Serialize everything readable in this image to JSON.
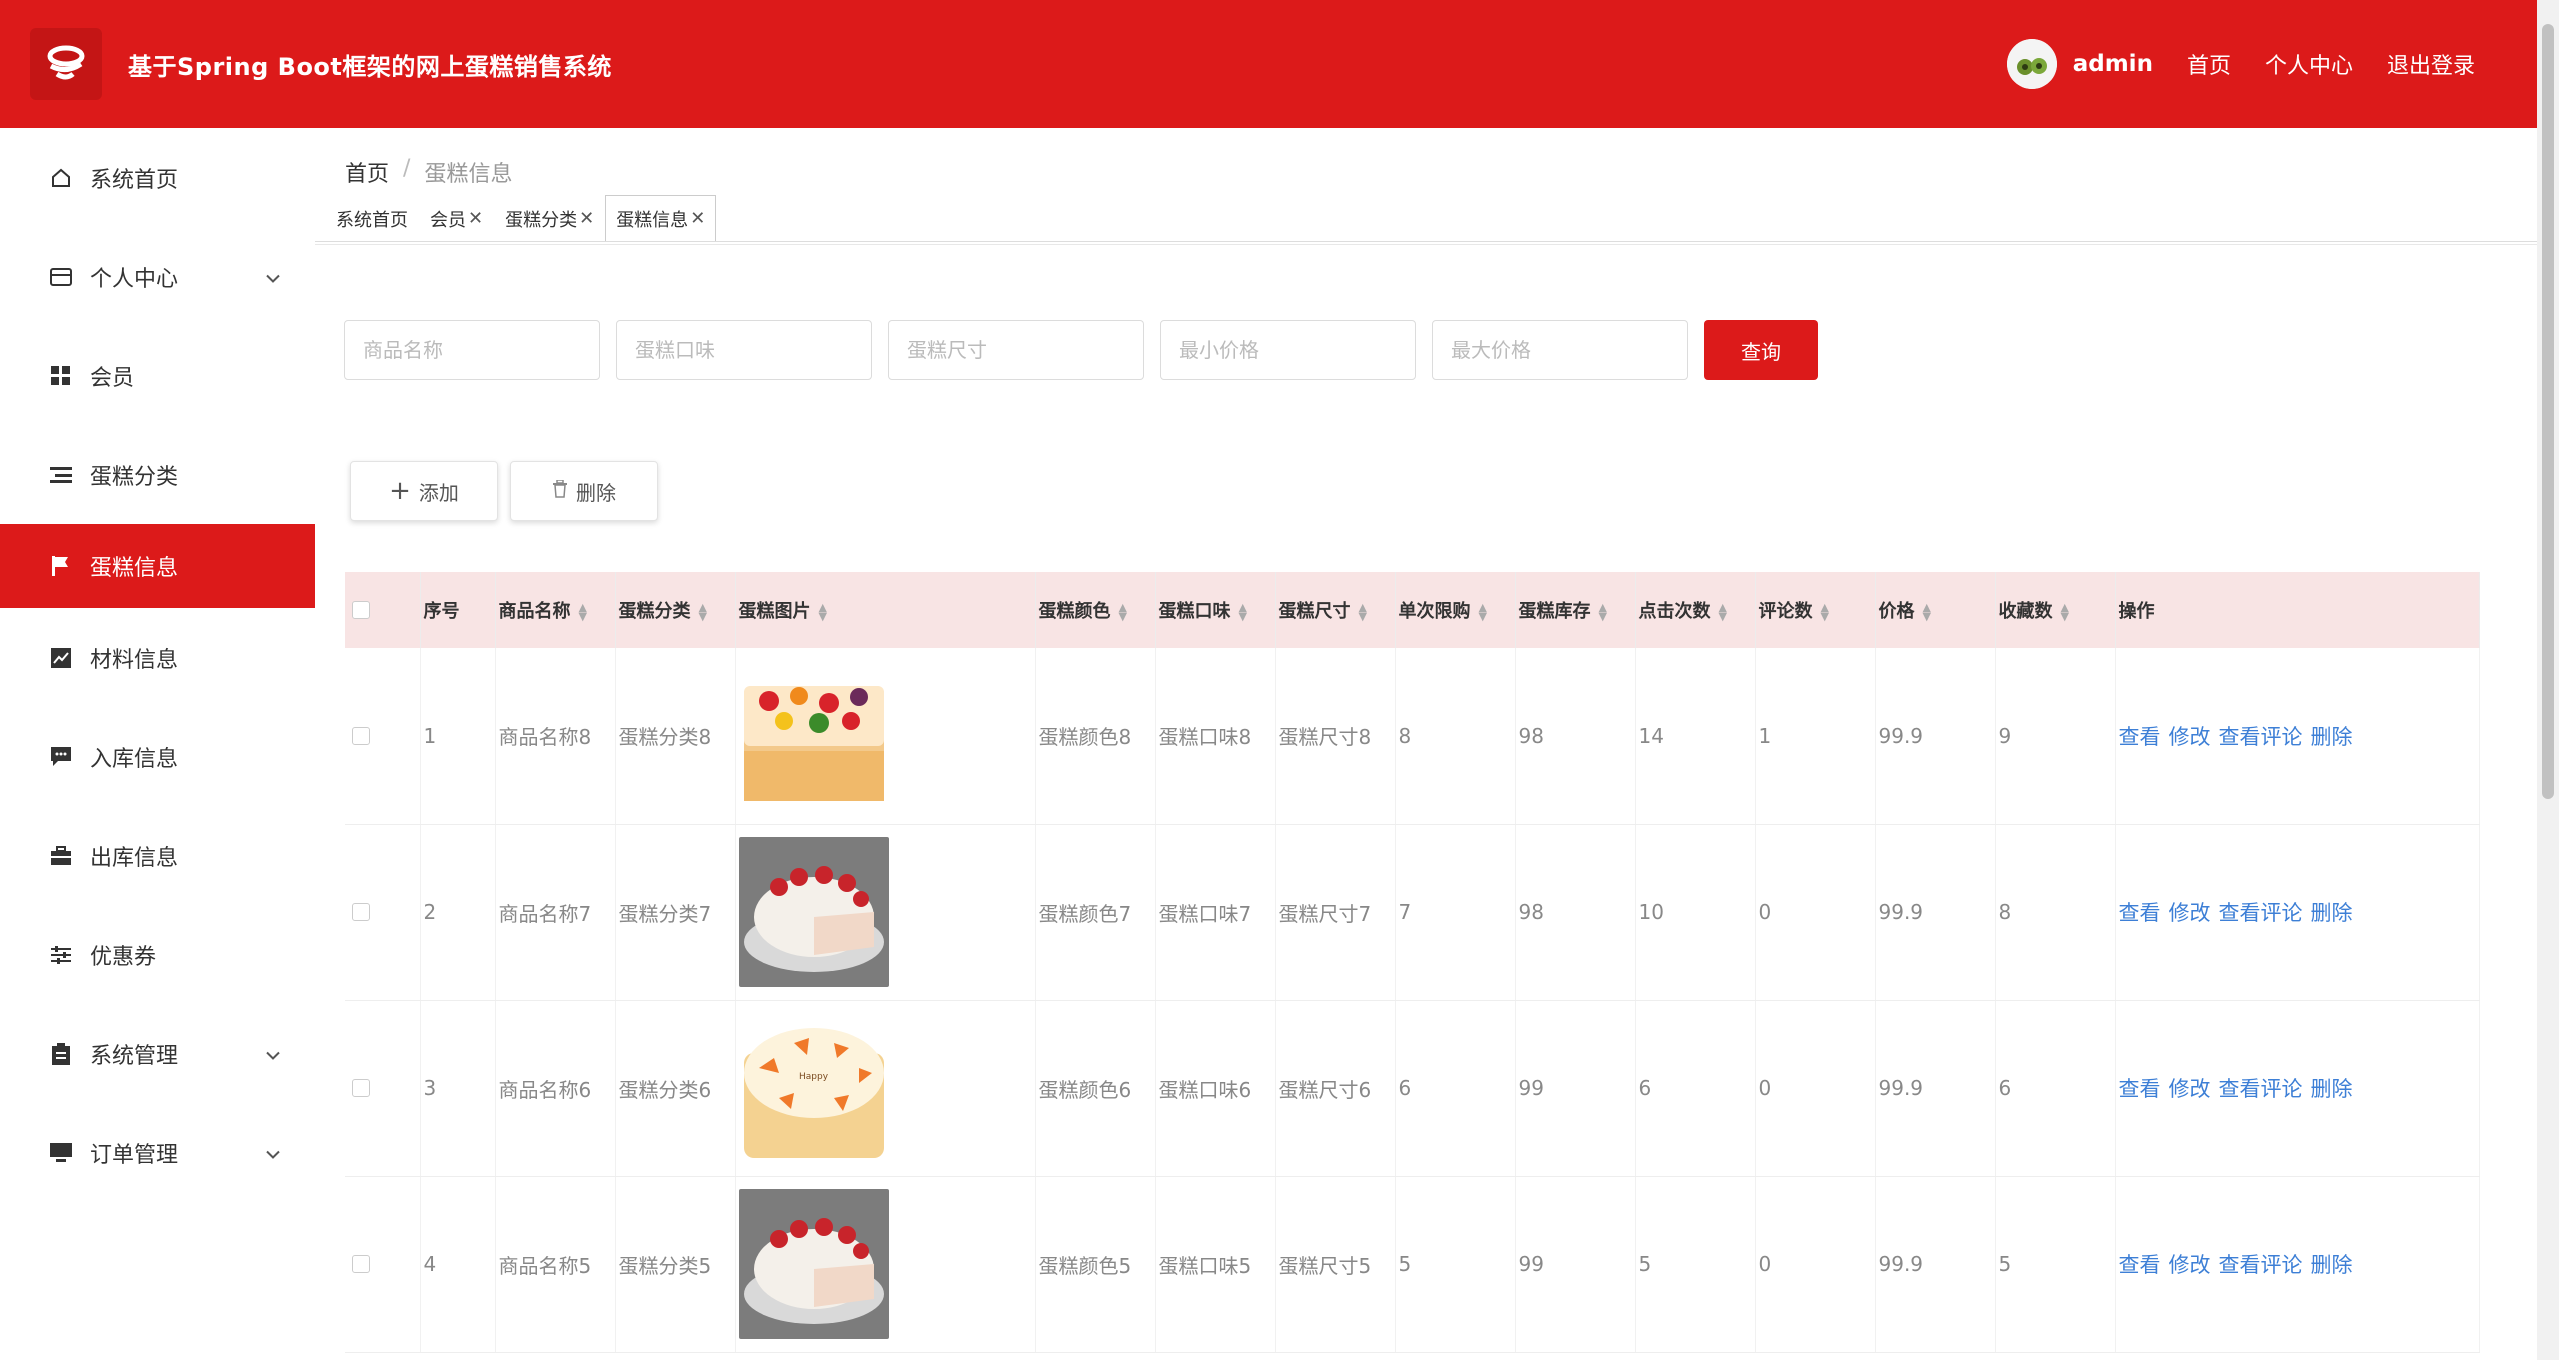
{
  "app": {
    "title": "基于Spring Boot框架的网上蛋糕销售系统"
  },
  "header": {
    "username": "admin",
    "links": [
      "首页",
      "个人中心",
      "退出登录"
    ]
  },
  "sidebar": {
    "items": [
      {
        "label": "系统首页",
        "icon": "home-icon",
        "chevron": false,
        "active": false
      },
      {
        "label": "个人中心",
        "icon": "card-icon",
        "chevron": true,
        "active": false
      },
      {
        "label": "会员",
        "icon": "grid-icon",
        "chevron": false,
        "active": false
      },
      {
        "label": "蛋糕分类",
        "icon": "list-icon",
        "chevron": false,
        "active": false
      },
      {
        "label": "蛋糕信息",
        "icon": "flag-icon",
        "chevron": false,
        "active": true
      },
      {
        "label": "材料信息",
        "icon": "chart-icon",
        "chevron": false,
        "active": false
      },
      {
        "label": "入库信息",
        "icon": "message-icon",
        "chevron": false,
        "active": false
      },
      {
        "label": "出库信息",
        "icon": "briefcase-icon",
        "chevron": false,
        "active": false
      },
      {
        "label": "优惠券",
        "icon": "sliders-icon",
        "chevron": false,
        "active": false
      },
      {
        "label": "系统管理",
        "icon": "clipboard-icon",
        "chevron": true,
        "active": false
      },
      {
        "label": "订单管理",
        "icon": "monitor-icon",
        "chevron": true,
        "active": false
      }
    ]
  },
  "breadcrumb": {
    "home": "首页",
    "separator": "/",
    "current": "蛋糕信息"
  },
  "tabs": [
    {
      "label": "系统首页",
      "closable": false,
      "active": false
    },
    {
      "label": "会员",
      "closable": true,
      "active": false
    },
    {
      "label": "蛋糕分类",
      "closable": true,
      "active": false
    },
    {
      "label": "蛋糕信息",
      "closable": true,
      "active": true
    }
  ],
  "search": {
    "placeholders": [
      "商品名称",
      "蛋糕口味",
      "蛋糕尺寸",
      "最小价格",
      "最大价格"
    ],
    "button": "查询"
  },
  "actions": {
    "add": "添加",
    "delete": "删除"
  },
  "table": {
    "columns": [
      "序号",
      "商品名称",
      "蛋糕分类",
      "蛋糕图片",
      "蛋糕颜色",
      "蛋糕口味",
      "蛋糕尺寸",
      "单次限购",
      "蛋糕库存",
      "点击次数",
      "评论数",
      "价格",
      "收藏数",
      "操作"
    ],
    "ops": [
      "查看",
      "修改",
      "查看评论",
      "删除"
    ],
    "rows": [
      {
        "no": "1",
        "name": "商品名称8",
        "category": "蛋糕分类8",
        "image": "fruit-cake",
        "color": "蛋糕颜色8",
        "taste": "蛋糕口味8",
        "size": "蛋糕尺寸8",
        "limit": "8",
        "stock": "98",
        "clicks": "14",
        "comments": "1",
        "price": "99.9",
        "favorites": "9"
      },
      {
        "no": "2",
        "name": "商品名称7",
        "category": "蛋糕分类7",
        "image": "strawberry-cake",
        "color": "蛋糕颜色7",
        "taste": "蛋糕口味7",
        "size": "蛋糕尺寸7",
        "limit": "7",
        "stock": "98",
        "clicks": "10",
        "comments": "0",
        "price": "99.9",
        "favorites": "8"
      },
      {
        "no": "3",
        "name": "商品名称6",
        "category": "蛋糕分类6",
        "image": "carrot-cake",
        "color": "蛋糕颜色6",
        "taste": "蛋糕口味6",
        "size": "蛋糕尺寸6",
        "limit": "6",
        "stock": "99",
        "clicks": "6",
        "comments": "0",
        "price": "99.9",
        "favorites": "6"
      },
      {
        "no": "4",
        "name": "商品名称5",
        "category": "蛋糕分类5",
        "image": "strawberry-cake",
        "color": "蛋糕颜色5",
        "taste": "蛋糕口味5",
        "size": "蛋糕尺寸5",
        "limit": "5",
        "stock": "99",
        "clicks": "5",
        "comments": "0",
        "price": "99.9",
        "favorites": "5"
      }
    ]
  },
  "colors": {
    "primary": "#dc1a1a",
    "link": "#3d7fd6",
    "header_row": "#f8e4e4"
  }
}
